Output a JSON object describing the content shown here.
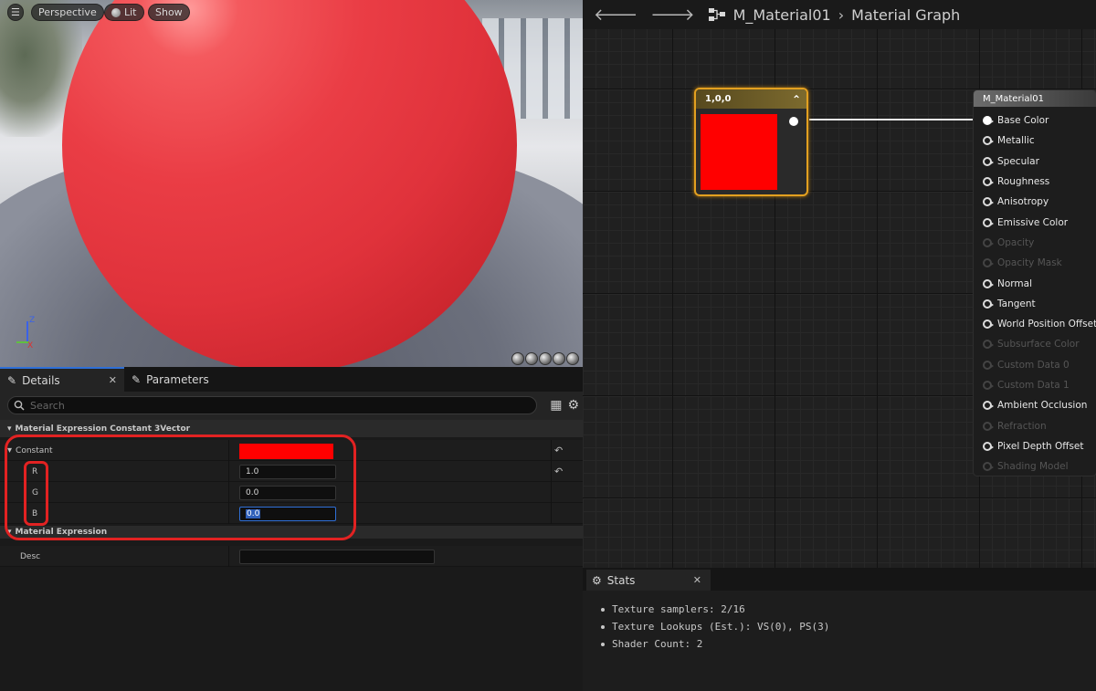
{
  "viewport": {
    "menu_icon": "hamburger-icon",
    "perspective_label": "Perspective",
    "lit_label": "Lit",
    "show_label": "Show",
    "axis_z": "Z",
    "axis_x": "X"
  },
  "details": {
    "tabs": [
      {
        "label": "Details",
        "icon": "pencil-icon",
        "active": true
      },
      {
        "label": "Parameters",
        "icon": "pencil-icon",
        "active": false
      }
    ],
    "search_placeholder": "Search",
    "category_constant": "Material Expression Constant 3Vector",
    "constant_label": "Constant",
    "constant_color": "#ff0000",
    "rows": [
      {
        "label": "R",
        "value": "1.0"
      },
      {
        "label": "G",
        "value": "0.0"
      },
      {
        "label": "B",
        "value": "0.0"
      }
    ],
    "category_expression": "Material Expression",
    "desc_label": "Desc",
    "desc_value": ""
  },
  "graph": {
    "breadcrumb_asset": "M_Material01",
    "breadcrumb_page": "Material Graph",
    "constant_node": {
      "title": "1,0,0",
      "color": "#ff0000"
    },
    "material_node": {
      "title": "M_Material01",
      "pins": [
        {
          "label": "Base Color",
          "state": "connected"
        },
        {
          "label": "Metallic",
          "state": "enabled"
        },
        {
          "label": "Specular",
          "state": "enabled"
        },
        {
          "label": "Roughness",
          "state": "enabled"
        },
        {
          "label": "Anisotropy",
          "state": "enabled"
        },
        {
          "label": "Emissive Color",
          "state": "enabled"
        },
        {
          "label": "Opacity",
          "state": "disabled"
        },
        {
          "label": "Opacity Mask",
          "state": "disabled"
        },
        {
          "label": "Normal",
          "state": "enabled"
        },
        {
          "label": "Tangent",
          "state": "enabled"
        },
        {
          "label": "World Position Offset",
          "state": "enabled"
        },
        {
          "label": "Subsurface Color",
          "state": "disabled"
        },
        {
          "label": "Custom Data 0",
          "state": "disabled"
        },
        {
          "label": "Custom Data 1",
          "state": "disabled"
        },
        {
          "label": "Ambient Occlusion",
          "state": "enabled"
        },
        {
          "label": "Refraction",
          "state": "disabled"
        },
        {
          "label": "Pixel Depth Offset",
          "state": "enabled"
        },
        {
          "label": "Shading Model",
          "state": "disabled"
        }
      ]
    }
  },
  "stats": {
    "tab_label": "Stats",
    "lines": [
      "Texture samplers: 2/16",
      "Texture Lookups (Est.): VS(0), PS(3)",
      "Shader Count: 2"
    ]
  },
  "colors": {
    "accent": "#2f6fd6",
    "annotation_red": "#e22222",
    "node_selected": "#e3a020"
  }
}
